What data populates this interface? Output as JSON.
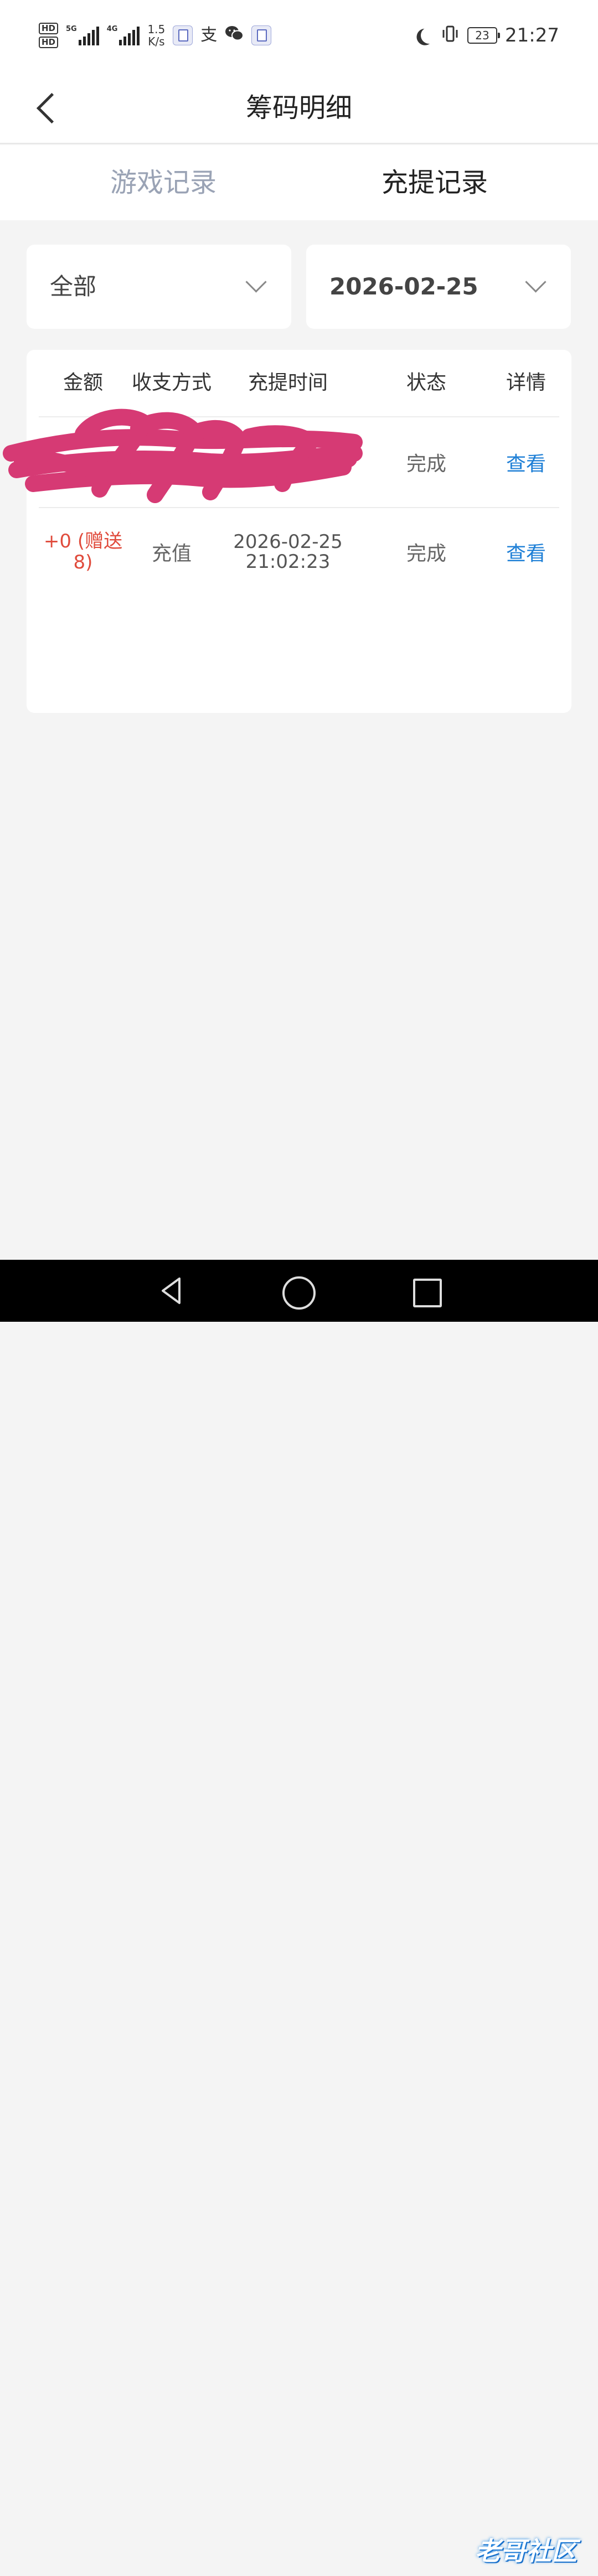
{
  "status_bar": {
    "hd1": "HD",
    "hd2": "HD",
    "net1": "5G",
    "net2": "4G",
    "speed_value": "1.5",
    "speed_unit": "K/s",
    "alipay_glyph": "支",
    "battery": "23",
    "time": "21:27"
  },
  "header": {
    "title": "筹码明细",
    "back_icon": "chevron-left-icon"
  },
  "tabs": [
    {
      "label": "游戏记录",
      "active": false
    },
    {
      "label": "充提记录",
      "active": true
    }
  ],
  "filters": {
    "type": {
      "value": "全部"
    },
    "date": {
      "value": "2026-02-25"
    }
  },
  "table": {
    "columns": [
      "金额",
      "收支方式",
      "充提时间",
      "状态",
      "详情"
    ],
    "rows": [
      {
        "amount": "",
        "method": "",
        "time_date": "",
        "time_clock": "",
        "status": "完成",
        "detail": "查看",
        "redacted": true
      },
      {
        "amount": "+0 (赠送8)",
        "method": "充值",
        "time_date": "2026-02-25",
        "time_clock": "21:02:23",
        "status": "完成",
        "detail": "查看",
        "redacted": false
      }
    ]
  },
  "watermark": "老哥社区",
  "colors": {
    "accent_link": "#1e7fd6",
    "amount_red": "#e04b3c",
    "scribble": "#d63a74",
    "tab_inactive": "#9aa3b5"
  }
}
